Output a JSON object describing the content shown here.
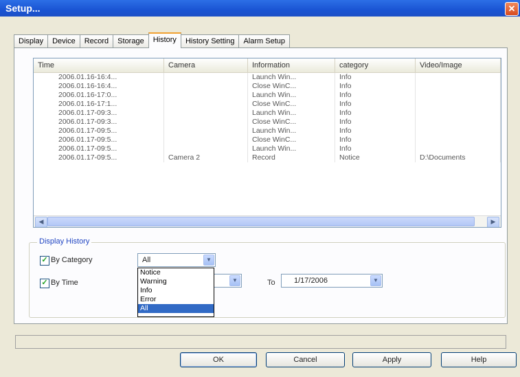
{
  "window": {
    "title": "Setup..."
  },
  "tabs": [
    {
      "label": "Display"
    },
    {
      "label": "Device"
    },
    {
      "label": "Record"
    },
    {
      "label": "Storage"
    },
    {
      "label": "History",
      "active": true
    },
    {
      "label": "History Setting"
    },
    {
      "label": "Alarm Setup"
    }
  ],
  "history_list": {
    "columns": [
      "Time",
      "Camera",
      "Information",
      "category",
      "Video/Image"
    ],
    "rows": [
      [
        "2006.01.16-16:4...",
        "",
        "Launch Win...",
        "Info",
        ""
      ],
      [
        "2006.01.16-16:4...",
        "",
        "Close WinC...",
        "Info",
        ""
      ],
      [
        "2006.01.16-17:0...",
        "",
        "Launch Win...",
        "Info",
        ""
      ],
      [
        "2006.01.16-17:1...",
        "",
        "Close WinC...",
        "Info",
        ""
      ],
      [
        "2006.01.17-09:3...",
        "",
        "Launch Win...",
        "Info",
        ""
      ],
      [
        "2006.01.17-09:3...",
        "",
        "Close WinC...",
        "Info",
        ""
      ],
      [
        "2006.01.17-09:5...",
        "",
        "Launch Win...",
        "Info",
        ""
      ],
      [
        "2006.01.17-09:5...",
        "",
        "Close WinC...",
        "Info",
        ""
      ],
      [
        "2006.01.17-09:5...",
        "",
        "Launch Win...",
        "Info",
        ""
      ],
      [
        "2006.01.17-09:5...",
        "Camera 2",
        "Record",
        "Notice",
        "D:\\Documents"
      ]
    ]
  },
  "display_history": {
    "title": "Display History",
    "by_category_label": "By Category",
    "by_category_checked": true,
    "category_value": "All",
    "category_options": [
      "Notice",
      "Warning",
      "Info",
      "Error",
      "All"
    ],
    "category_selected": "All",
    "by_time_label": "By Time",
    "by_time_checked": true,
    "to_label": "To",
    "to_date": "1/17/2006"
  },
  "buttons": {
    "ok": "OK",
    "cancel": "Cancel",
    "apply": "Apply",
    "help": "Help"
  },
  "icons": {
    "close": "close-icon",
    "dropdown": "chevron-down-icon",
    "scroll_left": "arrow-left-icon",
    "scroll_right": "arrow-right-icon"
  },
  "colors": {
    "titlebar": "#1a54d3",
    "selection": "#316ac5",
    "active_tab_accent": "#f1a131",
    "group_title": "#1f44c2"
  }
}
